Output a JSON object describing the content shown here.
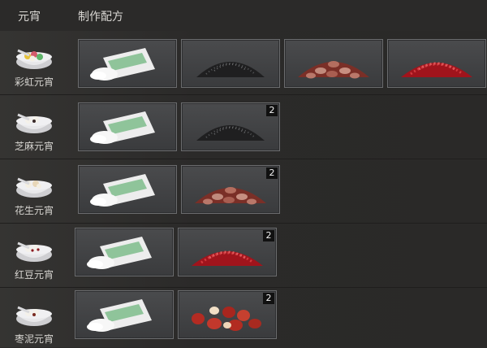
{
  "header": {
    "col_yuanxiao": "元宵",
    "col_recipe": "制作配方"
  },
  "rows": [
    {
      "name": "彩虹元宵",
      "ingredients": [
        {
          "icon": "glutinous-rice-flour-bag-icon",
          "qty": ""
        },
        {
          "icon": "black-sesame-icon",
          "qty": ""
        },
        {
          "icon": "peanut-icon",
          "qty": ""
        },
        {
          "icon": "red-bean-icon",
          "qty": ""
        }
      ]
    },
    {
      "name": "芝麻元宵",
      "ingredients": [
        {
          "icon": "glutinous-rice-flour-bag-icon",
          "qty": ""
        },
        {
          "icon": "black-sesame-icon",
          "qty": "2"
        }
      ]
    },
    {
      "name": "花生元宵",
      "ingredients": [
        {
          "icon": "glutinous-rice-flour-bag-icon",
          "qty": ""
        },
        {
          "icon": "peanut-icon",
          "qty": "2"
        }
      ]
    },
    {
      "name": "红豆元宵",
      "ingredients": [
        {
          "icon": "glutinous-rice-flour-bag-icon",
          "qty": ""
        },
        {
          "icon": "red-bean-icon",
          "qty": "2"
        }
      ]
    },
    {
      "name": "枣泥元宵",
      "ingredients": [
        {
          "icon": "glutinous-rice-flour-bag-icon",
          "qty": ""
        },
        {
          "icon": "red-date-icon",
          "qty": "2"
        }
      ]
    }
  ]
}
